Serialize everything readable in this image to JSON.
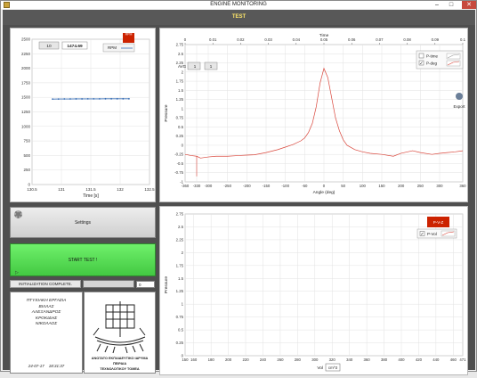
{
  "window": {
    "title": "ENGINE MONITORING",
    "minimize": "–",
    "maximize": "□",
    "close": "✕"
  },
  "header": {
    "title": "TEST"
  },
  "rpm_panel": {
    "plot_label": "RPM",
    "numeric_value": "10",
    "rpm_value": "1474.69",
    "legend_label": "RPM",
    "legend_color": "#cc2200",
    "x_label": "Time [s]",
    "x_ticks": [
      "130.5",
      "131",
      "131.5",
      "132",
      "132.5"
    ],
    "y_ticks": [
      "0",
      "250",
      "500",
      "750",
      "1000",
      "1250",
      "1500",
      "1750",
      "2000",
      "2250",
      "2500"
    ]
  },
  "pressure_angle_panel": {
    "top_axis_label": "Time",
    "top_ticks": [
      "0",
      "0.01",
      "0.02",
      "0.03",
      "0.04",
      "0.05",
      "0.06",
      "0.07",
      "0.08",
      "0.09",
      "0.1"
    ],
    "top_ticks_note": "Each drawn from Time values",
    "avg_label": "AVG",
    "avg_value": "1",
    "avg_value2": "1",
    "legend": [
      {
        "label": "P-time",
        "checked": false
      },
      {
        "label": "P-deg",
        "checked": true
      }
    ],
    "export_label": "Export",
    "y_label": "Pressure",
    "x_label": "Angle (deg)",
    "y_ticks": [
      "-1",
      "-0.75",
      "-0.5",
      "-0.25",
      "0",
      "0.25",
      "0.5",
      "0.75",
      "1",
      "1.25",
      "1.5",
      "1.75",
      "2",
      "2.25",
      "2.5",
      "2.75"
    ],
    "x_ticks": [
      "-360",
      "-330",
      "-300",
      "-250",
      "-200",
      "-150",
      "-100",
      "-50",
      "0",
      "50",
      "100",
      "150",
      "200",
      "250",
      "300",
      "360"
    ]
  },
  "pv_panel": {
    "legend_label": "P-V-Z",
    "legend_color": "#cc2200",
    "series_label": "P-Vol",
    "y_label": "Pressure",
    "x_label": "Vol",
    "x_unit": "cm^3",
    "y_ticks": [
      "0",
      "0.25",
      "0.5",
      "0.75",
      "1",
      "1.25",
      "1.5",
      "1.75",
      "2",
      "2.25",
      "2.5",
      "2.75"
    ],
    "x_ticks": [
      "150",
      "160",
      "180",
      "200",
      "220",
      "240",
      "260",
      "280",
      "300",
      "320",
      "340",
      "360",
      "380",
      "400",
      "420",
      "440",
      "460",
      "471"
    ]
  },
  "controls": {
    "settings_label": "Settings",
    "start_label": "START TEST !",
    "init_label": "INITIALIZATION COMPLETE.",
    "progress_fraction": 0,
    "progress_value": "0"
  },
  "credits": {
    "lines": [
      "ΠΤΥΧΙΑΚΗ ΕΡΓΑΣΙΑ",
      "ΒΙΛΛΑΣ",
      "ΑΛΕΞΑΝΔΡΟΣ",
      "",
      "ΚΡΟΚΙΔΗΣ",
      "ΝΙΚΟΛΑΟΣ"
    ],
    "date": "24-07-17",
    "time": "18:31:37"
  },
  "logo": {
    "line1": "ΑΝΩΤΑΤΟ ΕΚΠΑΙΔΕΥΤΙΚΟ ΙΔΡΥΜΑ ΠΕΙΡΑΙΑ",
    "line2": "ΤΕΧΝΟΛΟΓΙΚΟΥ ΤΟΜΕΑ"
  },
  "chart_data": [
    {
      "type": "line",
      "title": "",
      "xlabel": "Time [s]",
      "ylabel": "",
      "xlim": [
        130.5,
        132.5
      ],
      "ylim": [
        0,
        2500
      ],
      "grid": true,
      "series": [
        {
          "name": "RPM",
          "x": [
            130.85,
            130.95,
            131.05,
            131.15,
            131.25,
            131.35,
            131.45,
            131.55,
            131.65,
            131.75,
            131.85,
            131.95,
            132.05,
            132.15
          ],
          "y": [
            1470,
            1471,
            1472,
            1472,
            1473,
            1473,
            1474,
            1474,
            1474,
            1475,
            1475,
            1475,
            1475,
            1475
          ]
        }
      ]
    },
    {
      "type": "line",
      "title": "",
      "xlabel": "Angle (deg)",
      "ylabel": "Pressure",
      "xlim": [
        -360,
        360
      ],
      "ylim": [
        -1,
        2.75
      ],
      "grid": true,
      "series": [
        {
          "name": "P-deg",
          "x": [
            -360,
            -345,
            -330,
            -320,
            -300,
            -280,
            -250,
            -220,
            -200,
            -180,
            -150,
            -120,
            -100,
            -80,
            -60,
            -50,
            -40,
            -30,
            -20,
            -10,
            0,
            10,
            20,
            30,
            40,
            50,
            60,
            80,
            100,
            120,
            150,
            180,
            200,
            230,
            250,
            280,
            300,
            320,
            340,
            360
          ],
          "y": [
            -0.25,
            -0.28,
            -0.3,
            -0.35,
            -0.32,
            -0.3,
            -0.3,
            -0.28,
            -0.27,
            -0.26,
            -0.2,
            -0.12,
            -0.05,
            0.02,
            0.12,
            0.2,
            0.35,
            0.6,
            1.05,
            1.7,
            2.1,
            1.85,
            1.3,
            0.75,
            0.4,
            0.15,
            0.0,
            -0.12,
            -0.18,
            -0.22,
            -0.25,
            -0.3,
            -0.22,
            -0.15,
            -0.2,
            -0.25,
            -0.22,
            -0.2,
            -0.18,
            -0.15
          ]
        }
      ]
    },
    {
      "type": "line",
      "title": "",
      "xlabel": "Vol",
      "ylabel": "Pressure",
      "xlim": [
        150,
        471
      ],
      "ylim": [
        0,
        2.75
      ],
      "grid": true,
      "series": []
    }
  ]
}
